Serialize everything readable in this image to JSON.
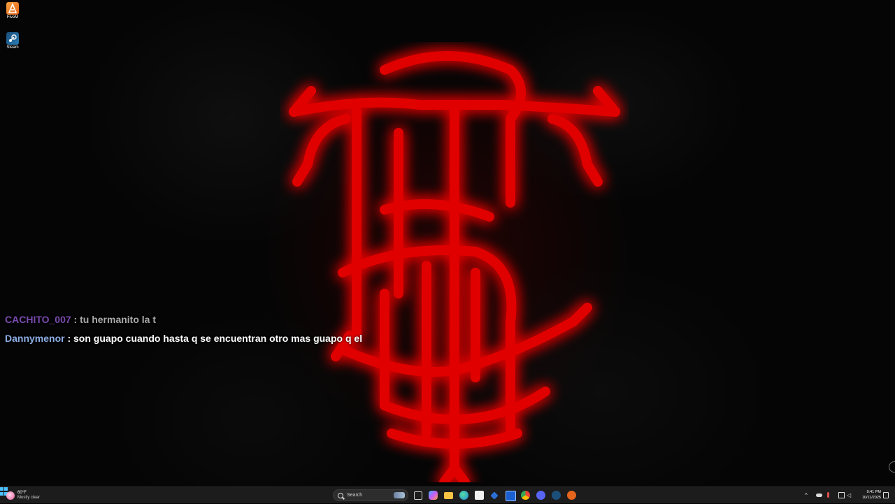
{
  "desktop": {
    "icons": [
      {
        "label": "FiveM",
        "icon": "fivem-icon"
      },
      {
        "label": "Steam",
        "icon": "steam-icon"
      }
    ],
    "wallpaper_accent": "#e00000"
  },
  "chat": {
    "messages": [
      {
        "user": "CACHITO_007",
        "text": " : tu hermanito la t",
        "user_color": "#7a4bb0"
      },
      {
        "user": "Dannymenor",
        "text": " : son guapo cuando hasta q se encuentran otro mas guapo q el",
        "user_color": "#8fb0e6"
      }
    ]
  },
  "taskbar": {
    "weather": {
      "temp": "60°F",
      "condition": "Mostly clear"
    },
    "search_placeholder": "Search",
    "pinned_apps": [
      "file-explorer-icon",
      "copilot-icon",
      "folder-icon",
      "edge-icon",
      "store-icon",
      "app-icon",
      "app-icon",
      "chrome-icon",
      "discord-icon",
      "steam-icon",
      "fivem-icon"
    ],
    "clock": {
      "time": "9:41 PM",
      "date": "10/11/2025"
    }
  }
}
